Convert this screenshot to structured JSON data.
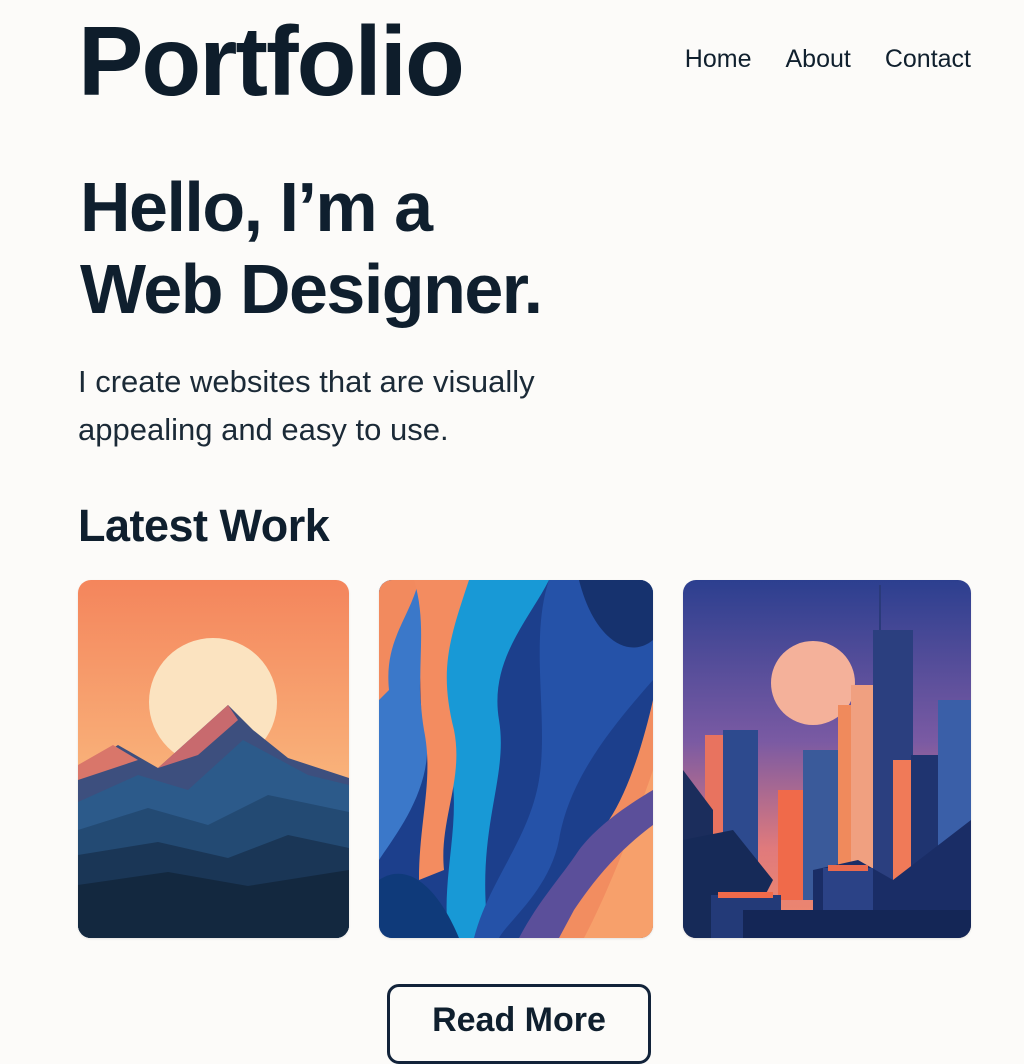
{
  "header": {
    "logo": "Portfolio",
    "nav": [
      "Home",
      "About",
      "Contact"
    ]
  },
  "hero": {
    "line1": "Hello, I’m a",
    "line2": "Web Designer.",
    "subtitle_line1": "I create websites that are visually",
    "subtitle_line2": "appealing and easy to use."
  },
  "work": {
    "title": "Latest Work",
    "cards": [
      {
        "image": "mountain-sunset-illustration"
      },
      {
        "image": "abstract-waves-illustration"
      },
      {
        "image": "city-skyline-illustration"
      }
    ]
  },
  "cta": {
    "label": "Read More"
  },
  "colors": {
    "background": "#fcfbf9",
    "text": "#0f1f2e",
    "sunset_orange": "#f4875d",
    "deep_blue": "#1d3a78"
  }
}
